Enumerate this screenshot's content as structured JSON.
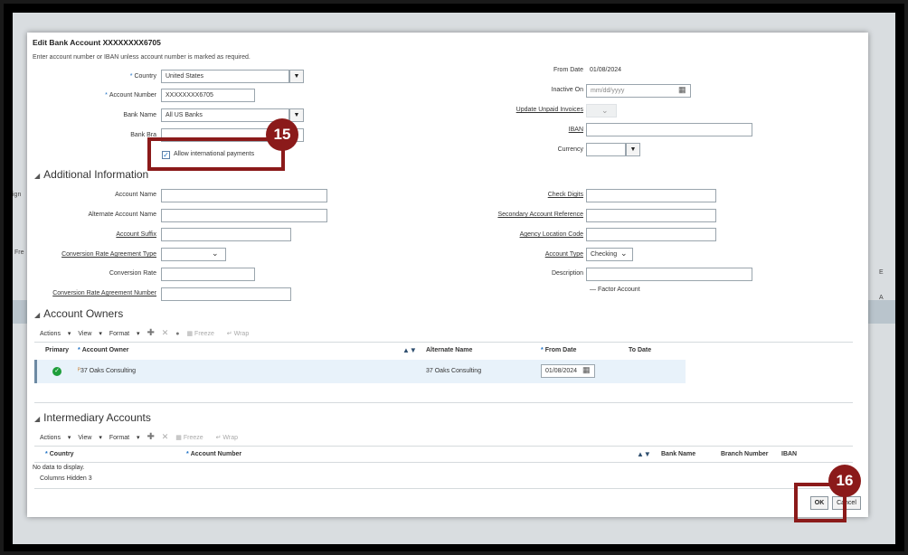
{
  "dialog": {
    "title": "Edit Bank Account XXXXXXXX6705",
    "instruction": "Enter account number or IBAN unless account number is marked as required."
  },
  "left_fields": {
    "country": {
      "label": "Country",
      "value": "United States"
    },
    "account_number": {
      "label": "Account Number",
      "value": "XXXXXXXX6705"
    },
    "bank_name": {
      "label": "Bank Name",
      "value": "All US Banks"
    },
    "bank_branch": {
      "label": "Bank Bra",
      "value": ""
    },
    "allow_international": {
      "label": "Allow international payments",
      "checked": true
    }
  },
  "right_fields": {
    "from_date": {
      "label": "From Date",
      "value": "01/08/2024"
    },
    "inactive_on": {
      "label": "Inactive On",
      "placeholder": "mm/dd/yyyy"
    },
    "update_unpaid": {
      "label": "Update Unpaid Invoices"
    },
    "iban": {
      "label": "IBAN",
      "value": ""
    },
    "currency": {
      "label": "Currency",
      "value": ""
    }
  },
  "additional_info": {
    "title": "Additional Information",
    "account_name": "Account Name",
    "alternate_account_name": "Alternate Account Name",
    "account_suffix": "Account Suffix",
    "conversion_rate_agreement_type": "Conversion Rate Agreement Type",
    "conversion_rate": "Conversion Rate",
    "conversion_rate_agreement_number": "Conversion Rate Agreement Number",
    "check_digits": "Check Digits",
    "secondary_account_reference": "Secondary Account Reference",
    "agency_location_code": "Agency Location Code",
    "account_type": {
      "label": "Account Type",
      "value": "Checking"
    },
    "description": "Description",
    "factor_account": "Factor Account"
  },
  "account_owners": {
    "title": "Account Owners",
    "toolbar": {
      "actions": "Actions",
      "view": "View",
      "format": "Format",
      "freeze": "Freeze",
      "wrap": "Wrap"
    },
    "columns": {
      "primary": "Primary",
      "account_owner": "Account Owner",
      "alternate_name": "Alternate Name",
      "from_date": "From Date",
      "to_date": "To Date"
    },
    "rows": [
      {
        "account_owner": "37 Oaks Consulting",
        "alternate_name": "37 Oaks Consulting",
        "from_date": "01/08/2024"
      }
    ]
  },
  "intermediary_accounts": {
    "title": "Intermediary Accounts",
    "toolbar": {
      "actions": "Actions",
      "view": "View",
      "format": "Format",
      "freeze": "Freeze",
      "wrap": "Wrap"
    },
    "columns": {
      "country": "Country",
      "account_number": "Account Number",
      "bank_name": "Bank Name",
      "branch_number": "Branch Number",
      "iban": "IBAN"
    },
    "empty": "No data to display.",
    "columns_hidden": "Columns Hidden  3"
  },
  "buttons": {
    "ok": "OK",
    "cancel": "Cancel"
  },
  "callouts": {
    "step15": "15",
    "step16": "16"
  },
  "background": {
    "frag_a": "A",
    "frag_e": "E",
    "frag_fre": "Fre",
    "frag_ign": "ign"
  },
  "colors": {
    "callout": "#8b1a1a",
    "accent": "#1a6fc4",
    "selected_row": "#e8f2fa"
  }
}
